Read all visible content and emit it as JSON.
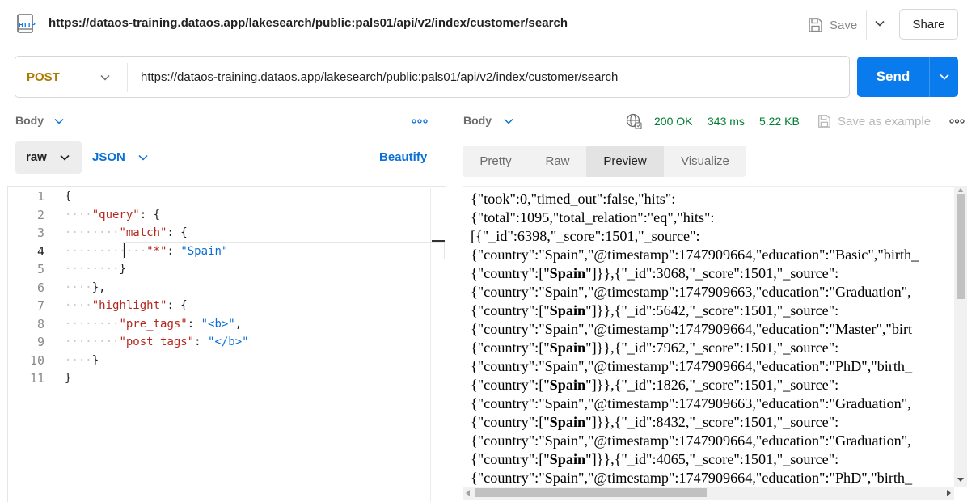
{
  "header": {
    "icon": "http-file-icon",
    "url": "https://dataos-training.dataos.app/lakesearch/public:pals01/api/v2/index/customer/search",
    "save_label": "Save",
    "share_label": "Share"
  },
  "request": {
    "method": "POST",
    "url": "https://dataos-training.dataos.app/lakesearch/public:pals01/api/v2/index/customer/search",
    "send_label": "Send"
  },
  "request_body": {
    "section_label": "Body",
    "mode": "raw",
    "format": "JSON",
    "beautify_label": "Beautify",
    "lines": [
      {
        "n": "1",
        "text": "{"
      },
      {
        "n": "2",
        "text": "\"query\": {"
      },
      {
        "n": "3",
        "text": "\"match\": {"
      },
      {
        "n": "4",
        "text": "\"*\": \"Spain\""
      },
      {
        "n": "5",
        "text": "}"
      },
      {
        "n": "6",
        "text": "},"
      },
      {
        "n": "7",
        "text": "\"highlight\": {"
      },
      {
        "n": "8",
        "text": "\"pre_tags\": \"<b>\","
      },
      {
        "n": "9",
        "text": "\"post_tags\": \"</b>\""
      },
      {
        "n": "10",
        "text": "}"
      },
      {
        "n": "11",
        "text": "}"
      }
    ]
  },
  "response": {
    "section_label": "Body",
    "status": "200 OK",
    "time": "343 ms",
    "size": "5.22 KB",
    "save_example_label": "Save as example",
    "tabs": [
      "Pretty",
      "Raw",
      "Preview",
      "Visualize"
    ],
    "active_tab": "Preview",
    "preview_lines": [
      "{\"took\":0,\"timed_out\":false,\"hits\":",
      "{\"total\":1095,\"total_relation\":\"eq\",\"hits\":",
      "[{\"_id\":6398,\"_score\":1501,\"_source\":",
      "{\"country\":\"Spain\",\"@timestamp\":1747909664,\"education\":\"Basic\",\"birth_",
      "{\"country\":[\"|Spain|\"]}},{\"_id\":3068,\"_score\":1501,\"_source\":",
      "{\"country\":\"Spain\",\"@timestamp\":1747909663,\"education\":\"Graduation\",",
      "{\"country\":[\"|Spain|\"]}},{\"_id\":5642,\"_score\":1501,\"_source\":",
      "{\"country\":\"Spain\",\"@timestamp\":1747909664,\"education\":\"Master\",\"birt",
      "{\"country\":[\"|Spain|\"]}},{\"_id\":7962,\"_score\":1501,\"_source\":",
      "{\"country\":\"Spain\",\"@timestamp\":1747909664,\"education\":\"PhD\",\"birth_",
      "{\"country\":[\"|Spain|\"]}},{\"_id\":1826,\"_score\":1501,\"_source\":",
      "{\"country\":\"Spain\",\"@timestamp\":1747909663,\"education\":\"Graduation\",",
      "{\"country\":[\"|Spain|\"]}},{\"_id\":8432,\"_score\":1501,\"_source\":",
      "{\"country\":\"Spain\",\"@timestamp\":1747909664,\"education\":\"Graduation\",",
      "{\"country\":[\"|Spain|\"]}},{\"_id\":4065,\"_score\":1501,\"_source\":",
      "{\"country\":\"Spain\",\"@timestamp\":1747909664,\"education\":\"PhD\",\"birth_"
    ]
  },
  "colors": {
    "accent": "#097bed",
    "method": "#ad7a03",
    "status_ok": "#007f31",
    "json_key": "#b5281f",
    "json_string": "#0a6fd6"
  }
}
